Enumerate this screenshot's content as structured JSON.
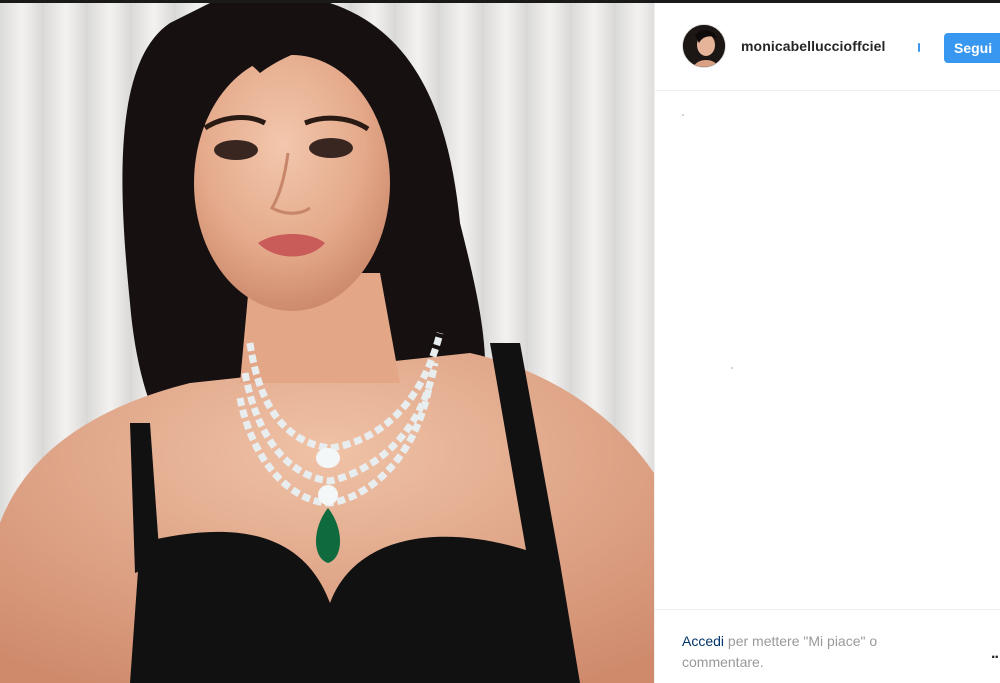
{
  "post": {
    "image_alt": "",
    "accent_color": "#3897f0",
    "link_color": "#003569"
  },
  "header": {
    "avatar_icon": "profile-avatar",
    "username": "monicabelluccioffciel",
    "verified_icon": "verified-badge-icon",
    "follow_label": "Segui"
  },
  "footer": {
    "login_link": "Accedi",
    "login_text": " per mettere \"Mi piace\" o commentare.",
    "more_label": ".."
  }
}
